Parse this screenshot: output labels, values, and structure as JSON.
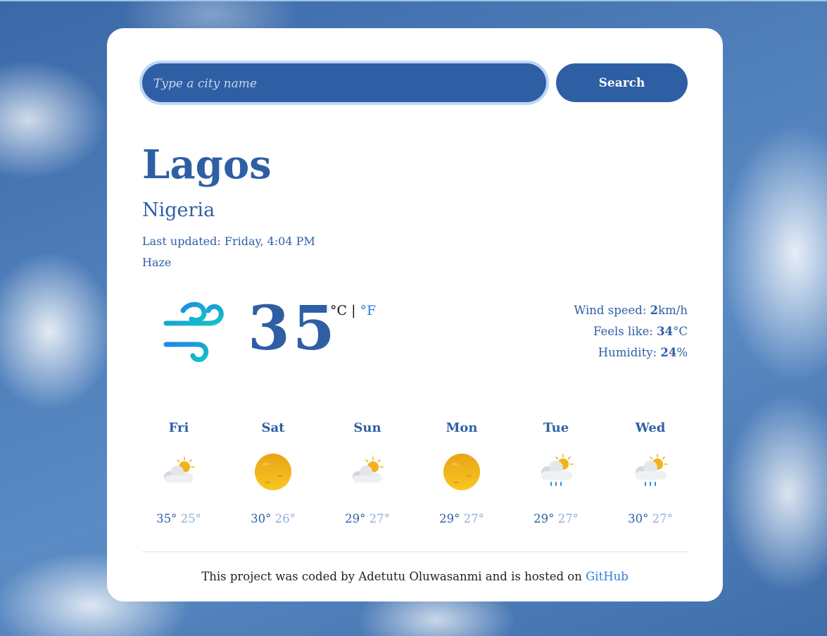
{
  "search": {
    "placeholder": "Type a city name",
    "value": "",
    "button_label": "Search"
  },
  "location": {
    "city": "Lagos",
    "country": "Nigeria"
  },
  "status": {
    "last_updated_label": "Last updated:",
    "last_updated": "Friday, 4:04 PM",
    "description": "Haze"
  },
  "current": {
    "icon": "wind-icon",
    "temperature": "35",
    "unit_celsius": "°C",
    "unit_separator": "|",
    "unit_fahrenheit": "°F",
    "wind_label": "Wind speed:",
    "wind_value": "2",
    "wind_unit": "km/h",
    "feels_label": "Feels like:",
    "feels_value": "34",
    "feels_unit": "°C",
    "humidity_label": "Humidity:",
    "humidity_value": "24",
    "humidity_unit": "%"
  },
  "forecast": [
    {
      "day": "Fri",
      "icon": "partly-cloudy-icon",
      "max": "35°",
      "min": "25°"
    },
    {
      "day": "Sat",
      "icon": "sun-icon",
      "max": "30°",
      "min": "26°"
    },
    {
      "day": "Sun",
      "icon": "partly-cloudy-icon",
      "max": "29°",
      "min": "27°"
    },
    {
      "day": "Mon",
      "icon": "sun-icon",
      "max": "29°",
      "min": "27°"
    },
    {
      "day": "Tue",
      "icon": "rain-showers-icon",
      "max": "29°",
      "min": "27°"
    },
    {
      "day": "Wed",
      "icon": "rain-showers-icon",
      "max": "30°",
      "min": "27°"
    }
  ],
  "footer": {
    "text": "This project was coded by Adetutu Oluwasanmi and is hosted on ",
    "link_label": "GitHub"
  },
  "colors": {
    "accent": "#2e5fa5",
    "link": "#2f7de1",
    "muted": "#8fb0d8"
  }
}
